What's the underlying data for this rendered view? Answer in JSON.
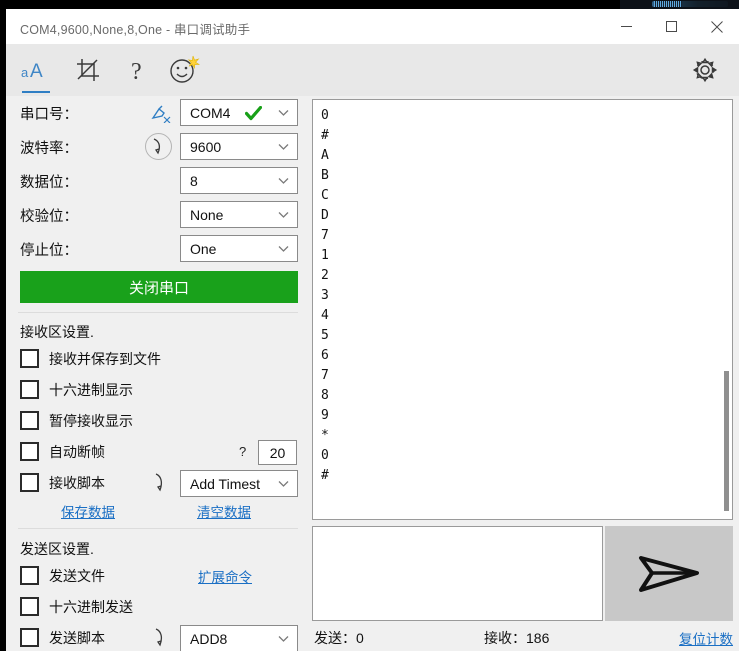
{
  "window": {
    "title": "COM4,9600,None,8,One - 串口调试助手",
    "minimize_label": "minimize",
    "maximize_label": "maximize",
    "close_label": "close"
  },
  "toolbar": {
    "items": [
      {
        "name": "font-size-icon",
        "label": "aA",
        "selected": true
      },
      {
        "name": "crop-icon",
        "label": "crop",
        "selected": false
      },
      {
        "name": "help-icon",
        "label": "?",
        "selected": false
      },
      {
        "name": "emoji-icon",
        "label": "smiley",
        "selected": false
      }
    ],
    "settings_label": "gear-icon"
  },
  "serial": {
    "fields": [
      {
        "label": "串口号：",
        "value": "COM4",
        "checked": true
      },
      {
        "label": "波特率：",
        "value": "9600",
        "checked": false
      },
      {
        "label": "数据位：",
        "value": "8",
        "checked": false
      },
      {
        "label": "校验位：",
        "value": "None",
        "checked": false
      },
      {
        "label": "停止位：",
        "value": "One",
        "checked": false
      }
    ],
    "toggle_button": "关闭串口",
    "toggle_color": "#19a11b",
    "scan_icon": "refresh-ports-icon",
    "script_icon": "script-icon"
  },
  "receive_settings": {
    "title": "接收区设置.",
    "checkboxes": [
      {
        "label": "接收并保存到文件",
        "checked": false
      },
      {
        "label": "十六进制显示",
        "checked": false
      },
      {
        "label": "暂停接收显示",
        "checked": false
      },
      {
        "label": "自动断帧",
        "checked": false
      },
      {
        "label": "接收脚本",
        "checked": false
      }
    ],
    "frame_help": "?",
    "frame_timeout": "20",
    "script_select": "Add Timest",
    "save_link": "保存数据",
    "clear_link": "清空数据"
  },
  "send_settings": {
    "title": "发送区设置.",
    "checkboxes": [
      {
        "label": "发送文件",
        "checked": false
      },
      {
        "label": "十六进制发送",
        "checked": false
      },
      {
        "label": "发送脚本",
        "checked": false
      }
    ],
    "extend_link": "扩展命令",
    "script_select": "ADD8"
  },
  "receive_area": {
    "content": "0\n#\nA\nB\nC\nD\n7\n1\n2\n3\n4\n5\n6\n7\n8\n9\n*\n0\n#",
    "scroll_position": "bottom"
  },
  "send_area": {
    "value": "",
    "placeholder": "",
    "send_button_icon": "paper-plane-icon"
  },
  "status": {
    "sent": "发送：0",
    "received": "接收：186",
    "reset_link": "复位计数"
  },
  "colors": {
    "accent_green": "#19a11b",
    "link_blue": "#1a6fc4",
    "toolbar_blue": "#2f7ec4",
    "window_bg": "#f0f0f0",
    "toolbar_bg": "#e8e8e8"
  }
}
